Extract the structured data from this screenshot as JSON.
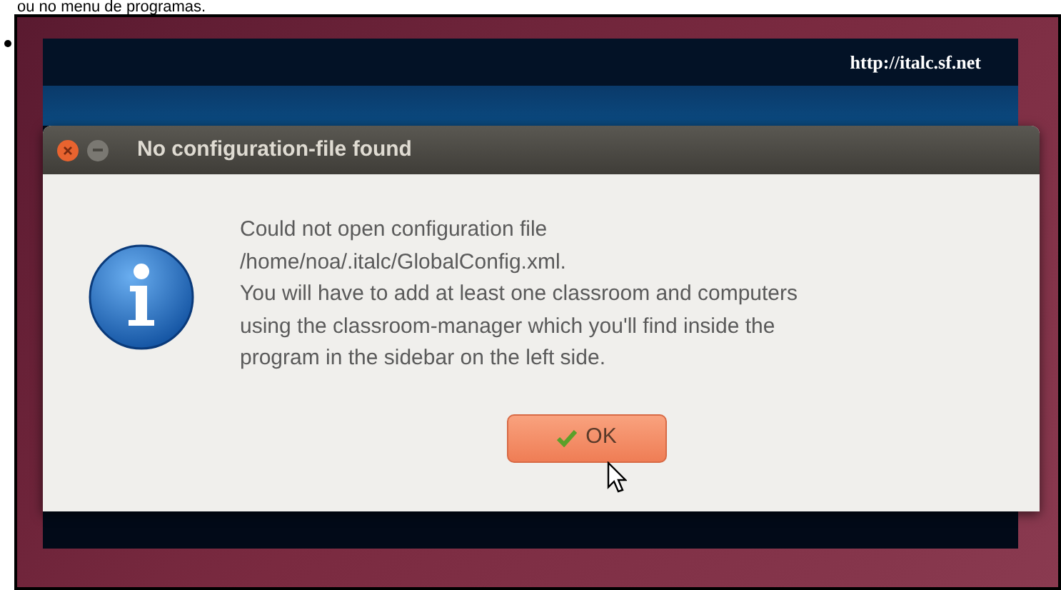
{
  "page_text": "ou no menu de programas.",
  "splash": {
    "url": "http://italc.sf.net"
  },
  "dialog": {
    "title": "No configuration-file found",
    "message": [
      "Could not open configuration file",
      "/home/noa/.italc/GlobalConfig.xml.",
      "You will have to add at least one classroom and computers",
      "using the classroom-manager which you'll find inside the",
      "program in the sidebar on the left side."
    ],
    "button": "OK"
  }
}
